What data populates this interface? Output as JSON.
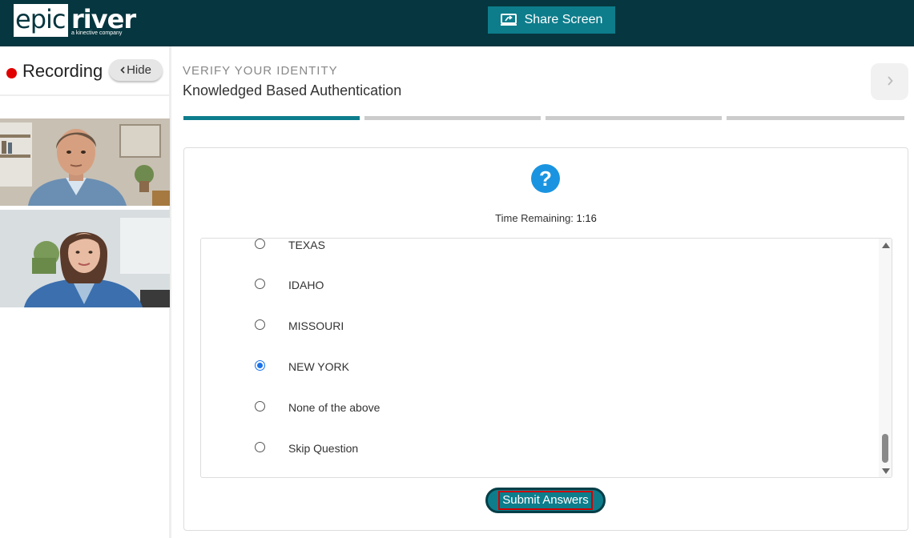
{
  "header": {
    "logo_left": "epic",
    "logo_right": "river",
    "logo_sub": "a kinective company",
    "share_label": "Share Screen",
    "colors": {
      "background": "#06363f",
      "accent": "#0d7d8c"
    }
  },
  "sidebar": {
    "recording_label": "Recording",
    "hide_label": "Hide",
    "hide_icon": "chevron-left-icon"
  },
  "step": {
    "kicker": "VERIFY YOUR IDENTITY",
    "title": "Knowledged Based Authentication",
    "progress_total": 4,
    "progress_current": 1
  },
  "question": {
    "icon": "question-icon",
    "timer_label": "Time Remaining:",
    "timer_value": "1:16",
    "options": [
      {
        "label": "TEXAS",
        "selected": false
      },
      {
        "label": "IDAHO",
        "selected": false
      },
      {
        "label": "MISSOURI",
        "selected": false
      },
      {
        "label": "NEW YORK",
        "selected": true
      },
      {
        "label": "None of the above",
        "selected": false
      },
      {
        "label": "Skip Question",
        "selected": false
      }
    ]
  },
  "submit_label": "Submit Answers"
}
